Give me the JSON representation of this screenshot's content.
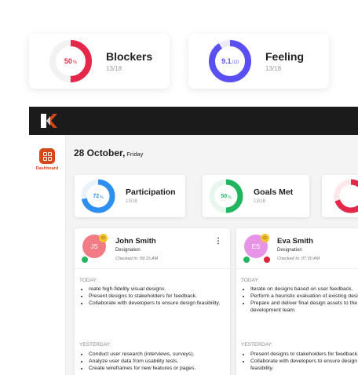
{
  "summary_cards": [
    {
      "title": "Blockers",
      "sub": "13/18",
      "value_text": "50",
      "unit": "%",
      "progress": 0.5,
      "color": "#e5284a"
    },
    {
      "title": "Feeling",
      "sub": "13/18",
      "value_text": "9.1",
      "unit": "/10",
      "progress": 0.91,
      "color": "#5a4ff0"
    }
  ],
  "app": {
    "logo_icon": "brand-logo-icon",
    "sidebar": {
      "dashboard_label": "Dashboard"
    },
    "date": "28 October,",
    "day": "Friday",
    "metrics": [
      {
        "title": "Participation",
        "sub": "13/18",
        "value_text": "72",
        "unit": "%",
        "progress": 0.72,
        "color": "#2d8ff0"
      },
      {
        "title": "Goals Met",
        "sub": "13/18",
        "value_text": "50",
        "unit": "%",
        "progress": 0.5,
        "color": "#22b45f"
      },
      {
        "title": "",
        "sub": "",
        "value_text": "",
        "unit": "",
        "progress": 0.7,
        "color": "#e5284a"
      }
    ],
    "people": [
      {
        "initials": "JS",
        "name": "John Smith",
        "designation": "Designation",
        "checked_in": "Checked In: 09:15 AM",
        "avatar_color": "#f27b86",
        "status": "online",
        "today_label": "TODAY:",
        "today": [
          "reate high-fidelity visual designs.",
          "Present designs to stakeholders for feedback.",
          "Collaborate with developers to ensure design feasibility."
        ],
        "yesterday_label": "YESTERDAY:",
        "yesterday": [
          "Conduct user research (interviews, surveys).",
          "Analyze user data from usability tests.",
          "Create wireframes for new features or pages."
        ]
      },
      {
        "initials": "ES",
        "name": "Eva Smith",
        "designation": "Designation",
        "checked_in": "Checked In: 07:30 AM",
        "avatar_color": "#e793e8",
        "status": "busy",
        "today_label": "TODAY:",
        "today": [
          "Iterate on designs based on user feedback.",
          "Perform a heuristic evaluation of existing designs.",
          "Prepare and deliver final design assets to the development team."
        ],
        "yesterday_label": "YESTERDAY:",
        "yesterday": [
          "Present designs to stakeholders for feedback.",
          "Collaborate with developers to ensure design feasibility."
        ]
      }
    ]
  }
}
